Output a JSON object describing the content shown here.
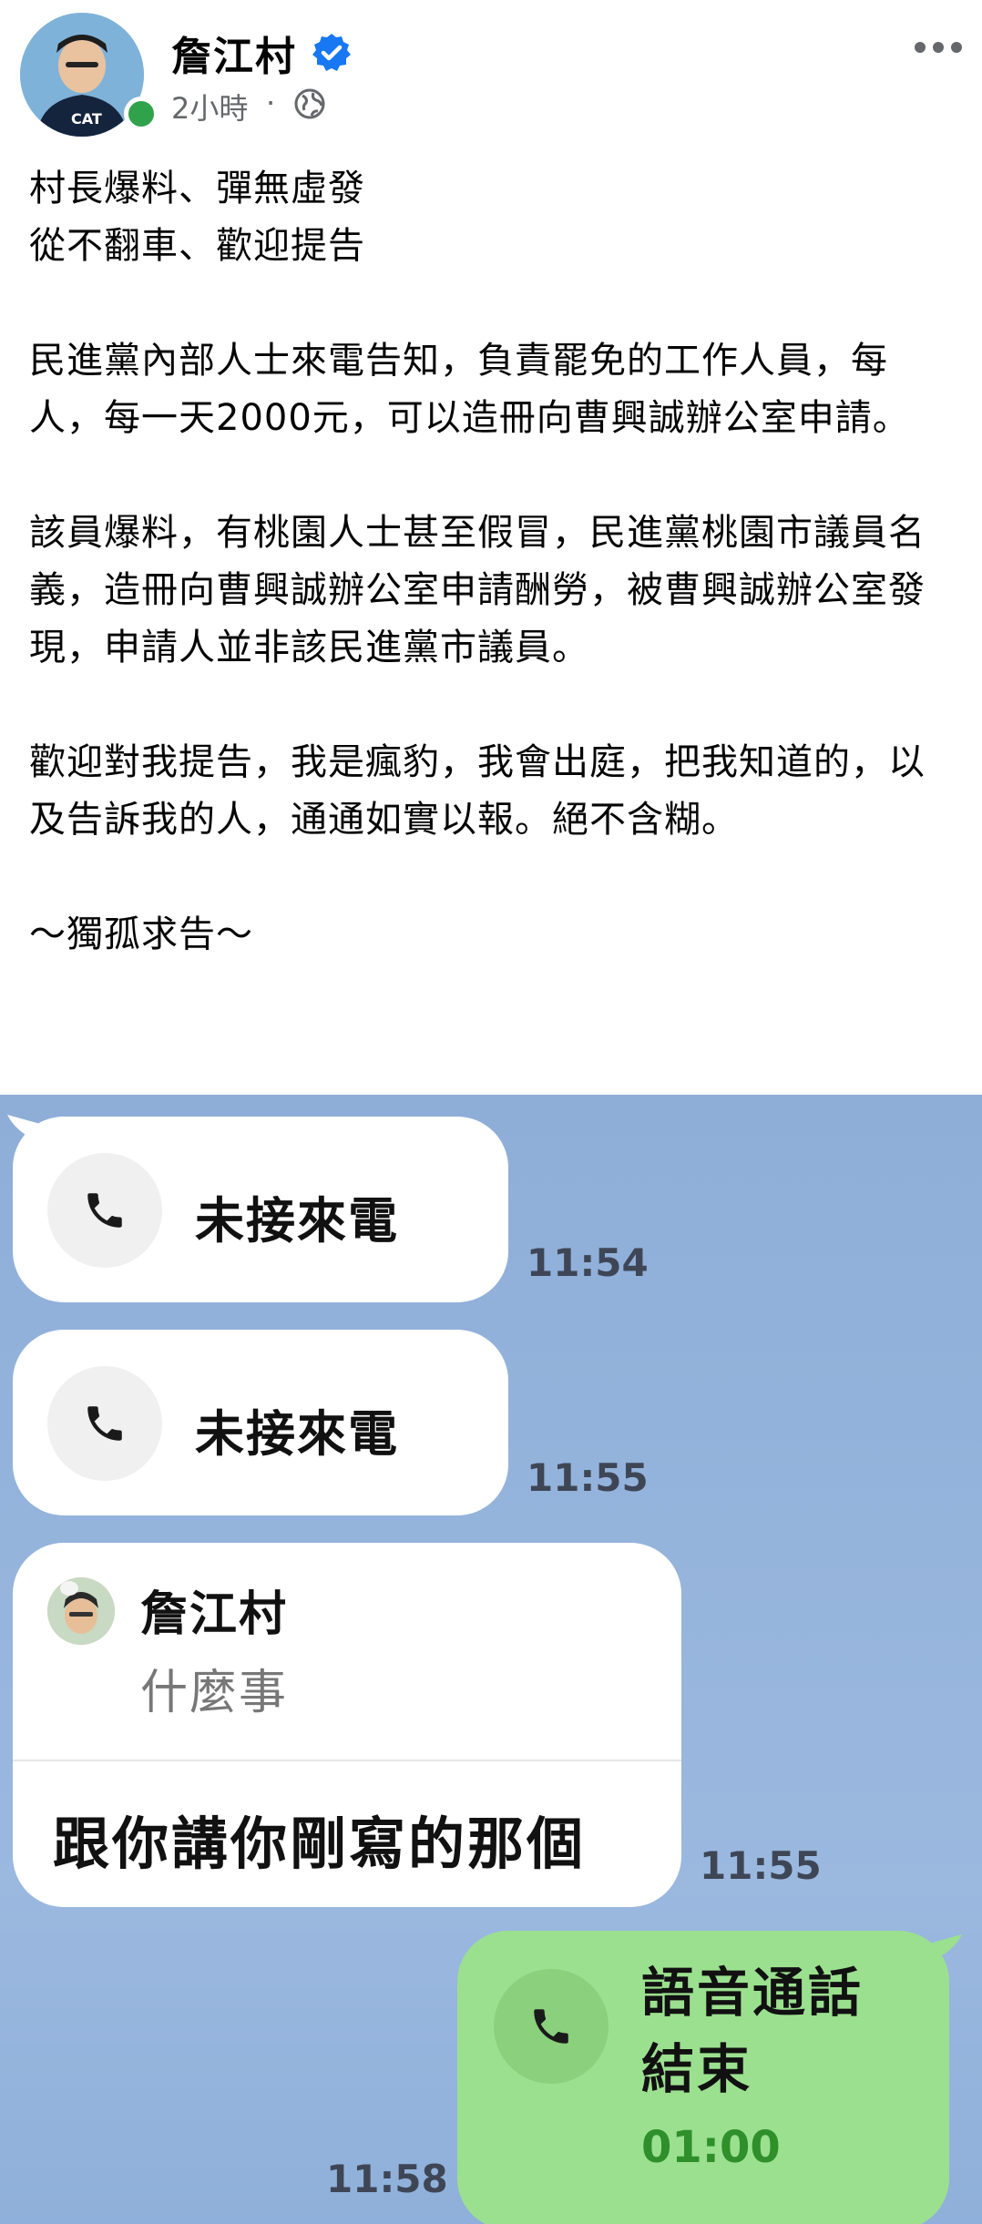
{
  "post": {
    "author": "詹江村",
    "time": "2小時",
    "separator": "·",
    "icons": {
      "verified": "verified-badge-icon",
      "audience": "globe-icon",
      "more": "more-options-icon"
    },
    "colors": {
      "online": "#31a24c",
      "verified": "#1877f2"
    },
    "body": {
      "p1_line1": "村長爆料、彈無虛發",
      "p1_line2": "從不翻車、歡迎提告",
      "p2": "民進黨內部人士來電告知，負責罷免的工作人員，每人，每一天2000元，可以造冊向曹興誠辦公室申請。",
      "p3": "該員爆料，有桃園人士甚至假冒，民進黨桃園市議員名義，造冊向曹興誠辦公室申請酬勞，被曹興誠辦公室發現，申請人並非該民進黨市議員。",
      "p4": "歡迎對我提告，我是瘋豹，我會出庭，把我知道的，以及告訴我的人，通通如實以報。絕不含糊。",
      "p5": "〜獨孤求告〜"
    }
  },
  "chat": {
    "colors": {
      "background": "#8eaed8",
      "outgoing_bubble": "#9be08f",
      "duration_text": "#2f8f2a"
    },
    "messages": [
      {
        "type": "missed_call",
        "label": "未接來電",
        "time": "11:54"
      },
      {
        "type": "missed_call",
        "label": "未接來電",
        "time": "11:55"
      },
      {
        "type": "reply",
        "quoted_name": "詹江村",
        "quoted_text": "什麼事",
        "text": "跟你講你剛寫的那個",
        "time": "11:55"
      },
      {
        "type": "voice_call_ended",
        "label_line1": "語音通話",
        "label_line2": "結束",
        "duration": "01:00",
        "time": "11:58"
      }
    ]
  }
}
